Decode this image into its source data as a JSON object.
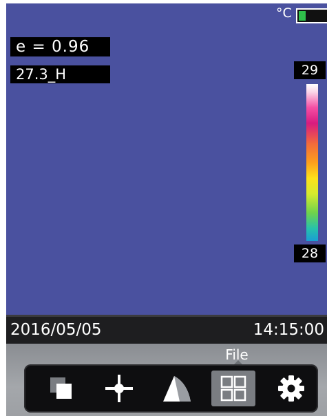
{
  "status": {
    "unit": "°C"
  },
  "overlay": {
    "emissivity": "e = 0.96",
    "mode": "27.3_H"
  },
  "scale": {
    "max": "29",
    "min": "28"
  },
  "info": {
    "date": "2016/05/05",
    "time": "14:15:00"
  },
  "menu": {
    "active_label": "File",
    "items": [
      {
        "icon": "image-copy-icon"
      },
      {
        "icon": "spot-crosshair-icon"
      },
      {
        "icon": "palette-icon"
      },
      {
        "icon": "file-grid-icon",
        "selected": true
      },
      {
        "icon": "gear-icon"
      }
    ]
  },
  "colors": {
    "background": "#4a519f",
    "battery": "#2fbf4a",
    "selected": "#7a7d82"
  }
}
